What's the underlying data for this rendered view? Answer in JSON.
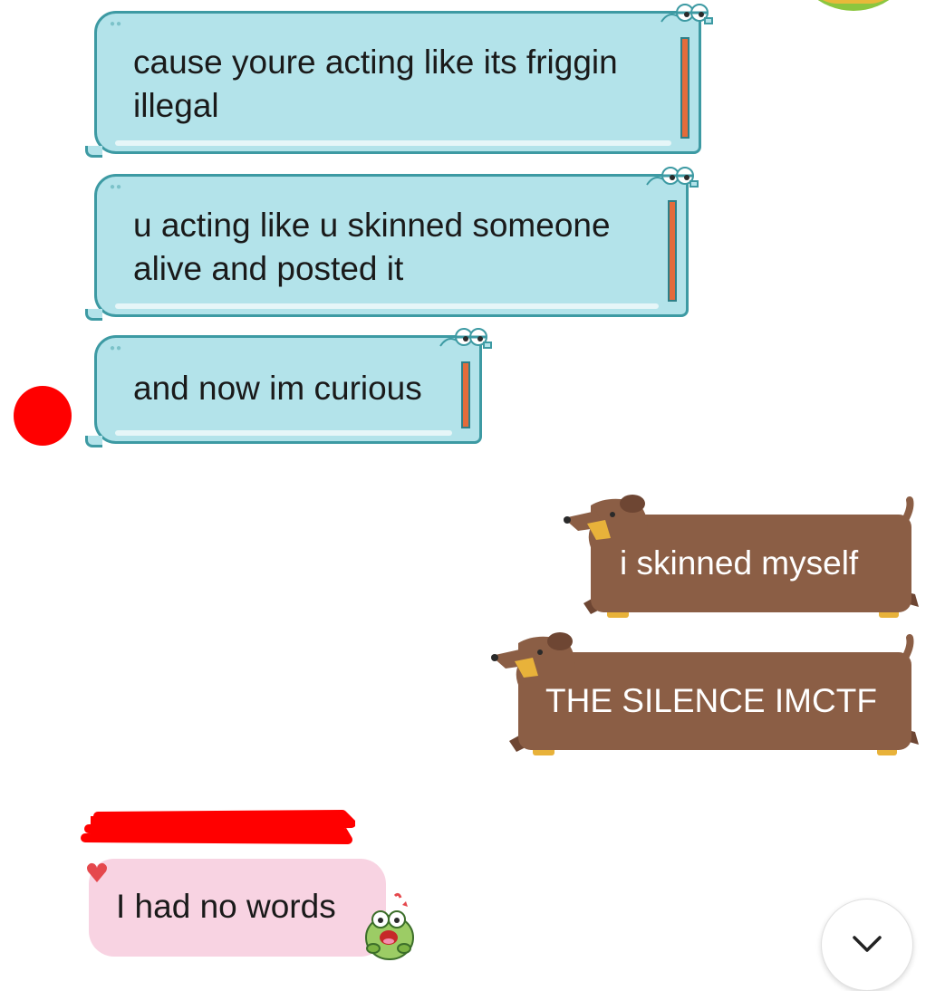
{
  "messages": {
    "received": [
      {
        "text": "cause youre acting like its friggin illegal"
      },
      {
        "text": "u acting like u skinned someone alive and posted it"
      },
      {
        "text": "and now im curious"
      }
    ],
    "sent": [
      {
        "text": "i skinned myself"
      },
      {
        "text": "THE SILENCE IMCTF"
      }
    ],
    "reply": {
      "text": "I had no words"
    }
  },
  "icons": {
    "reaction": "heart-icon",
    "sticker": "frog-sticker-icon",
    "scroll": "chevron-down-icon"
  },
  "colors": {
    "croc_bubble": "#b3e3ea",
    "croc_outline": "#3d9aa3",
    "dog_bubble": "#8b5e45",
    "reply_bubble": "#f8d3e2",
    "redaction": "#ff0000"
  }
}
